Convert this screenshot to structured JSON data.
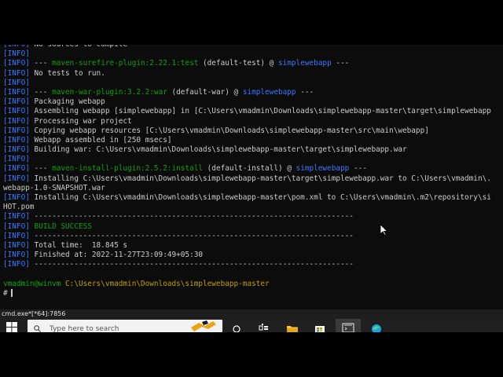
{
  "terminal": {
    "lines": [
      {
        "parts": [
          {
            "t": "[INFO]",
            "c": "tag"
          },
          {
            "t": " No sources to compile",
            "c": ""
          }
        ]
      },
      {
        "parts": [
          {
            "t": "[INFO]",
            "c": "tag"
          }
        ]
      },
      {
        "parts": [
          {
            "t": "[INFO]",
            "c": "tag"
          },
          {
            "t": " --- ",
            "c": ""
          },
          {
            "t": "maven-surefire-plugin:2.22.1:test",
            "c": "plugin"
          },
          {
            "t": " (default-test) @ ",
            "c": ""
          },
          {
            "t": "simplewebapp",
            "c": "project"
          },
          {
            "t": " ---",
            "c": ""
          }
        ]
      },
      {
        "parts": [
          {
            "t": "[INFO]",
            "c": "tag"
          },
          {
            "t": " No tests to run.",
            "c": ""
          }
        ]
      },
      {
        "parts": [
          {
            "t": "[INFO]",
            "c": "tag"
          }
        ]
      },
      {
        "parts": [
          {
            "t": "[INFO]",
            "c": "tag"
          },
          {
            "t": " --- ",
            "c": ""
          },
          {
            "t": "maven-war-plugin:3.2.2:war",
            "c": "plugin"
          },
          {
            "t": " (default-war) @ ",
            "c": ""
          },
          {
            "t": "simplewebapp",
            "c": "project"
          },
          {
            "t": " ---",
            "c": ""
          }
        ]
      },
      {
        "parts": [
          {
            "t": "[INFO]",
            "c": "tag"
          },
          {
            "t": " Packaging webapp",
            "c": ""
          }
        ]
      },
      {
        "parts": [
          {
            "t": "[INFO]",
            "c": "tag"
          },
          {
            "t": " Assembling webapp [simplewebapp] in [C:\\Users\\vmadmin\\Downloads\\simplewebapp-master\\target\\simplewebapp",
            "c": ""
          }
        ]
      },
      {
        "parts": [
          {
            "t": "[INFO]",
            "c": "tag"
          },
          {
            "t": " Processing war project",
            "c": ""
          }
        ]
      },
      {
        "parts": [
          {
            "t": "[INFO]",
            "c": "tag"
          },
          {
            "t": " Copying webapp resources [C:\\Users\\vmadmin\\Downloads\\simplewebapp-master\\src\\main\\webapp]",
            "c": ""
          }
        ]
      },
      {
        "parts": [
          {
            "t": "[INFO]",
            "c": "tag"
          },
          {
            "t": " Webapp assembled in [250 msecs]",
            "c": ""
          }
        ]
      },
      {
        "parts": [
          {
            "t": "[INFO]",
            "c": "tag"
          },
          {
            "t": " Building war: C:\\Users\\vmadmin\\Downloads\\simplewebapp-master\\target\\simplewebapp.war",
            "c": ""
          }
        ]
      },
      {
        "parts": [
          {
            "t": "[INFO]",
            "c": "tag"
          }
        ]
      },
      {
        "parts": [
          {
            "t": "[INFO]",
            "c": "tag"
          },
          {
            "t": " --- ",
            "c": ""
          },
          {
            "t": "maven-install-plugin:2.5.2:install",
            "c": "plugin"
          },
          {
            "t": " (default-install) @ ",
            "c": ""
          },
          {
            "t": "simplewebapp",
            "c": "project"
          },
          {
            "t": " ---",
            "c": ""
          }
        ]
      },
      {
        "parts": [
          {
            "t": "[INFO]",
            "c": "tag"
          },
          {
            "t": " Installing C:\\Users\\vmadmin\\Downloads\\simplewebapp-master\\target\\simplewebapp.war to C:\\Users\\vmadmin\\.",
            "c": ""
          }
        ]
      },
      {
        "parts": [
          {
            "t": "webapp-1.0-SNAPSHOT.war",
            "c": ""
          }
        ]
      },
      {
        "parts": [
          {
            "t": "[INFO]",
            "c": "tag"
          },
          {
            "t": " Installing C:\\Users\\vmadmin\\Downloads\\simplewebapp-master\\pom.xml to C:\\Users\\vmadmin\\.m2\\repository\\si",
            "c": ""
          }
        ]
      },
      {
        "parts": [
          {
            "t": "HOT.pom",
            "c": ""
          }
        ]
      },
      {
        "parts": [
          {
            "t": "[INFO]",
            "c": "tag"
          },
          {
            "t": " ------------------------------------------------------------------------",
            "c": "sep"
          }
        ]
      },
      {
        "parts": [
          {
            "t": "[INFO]",
            "c": "tag"
          },
          {
            "t": " ",
            "c": ""
          },
          {
            "t": "BUILD SUCCESS",
            "c": "success"
          }
        ]
      },
      {
        "parts": [
          {
            "t": "[INFO]",
            "c": "tag"
          },
          {
            "t": " ------------------------------------------------------------------------",
            "c": "sep"
          }
        ]
      },
      {
        "parts": [
          {
            "t": "[INFO]",
            "c": "tag"
          },
          {
            "t": " Total time:  18.845 s",
            "c": ""
          }
        ]
      },
      {
        "parts": [
          {
            "t": "[INFO]",
            "c": "tag"
          },
          {
            "t": " Finished at: 2022-11-27T23:09:49+05:30",
            "c": ""
          }
        ]
      },
      {
        "parts": [
          {
            "t": "[INFO]",
            "c": "tag"
          },
          {
            "t": " ------------------------------------------------------------------------",
            "c": "sep"
          }
        ]
      },
      {
        "parts": []
      },
      {
        "parts": [
          {
            "t": "vmadmin@winvm",
            "c": "prompt-user"
          },
          {
            "t": " ",
            "c": ""
          },
          {
            "t": "C:\\Users\\vmadmin\\Downloads\\simplewebapp-master",
            "c": "prompt-path"
          }
        ]
      },
      {
        "parts": [
          {
            "t": "#",
            "c": ""
          }
        ],
        "cursor": true
      }
    ]
  },
  "statusbar": {
    "text": "cmd.exe*[*64]:7856"
  },
  "taskbar": {
    "search_placeholder": "Type here to search",
    "icons": [
      "windows-start-icon",
      "task-view-icon",
      "widgets-icon",
      "file-explorer-icon",
      "store-icon",
      "terminal-app-icon",
      "edge-browser-icon"
    ]
  },
  "colors": {
    "terminal_bg": "#0c0c0c",
    "info_tag": "#3b78ff",
    "plugin": "#13a10e",
    "success": "#13a10e",
    "prompt_path": "#c19c00",
    "text": "#cccccc"
  }
}
